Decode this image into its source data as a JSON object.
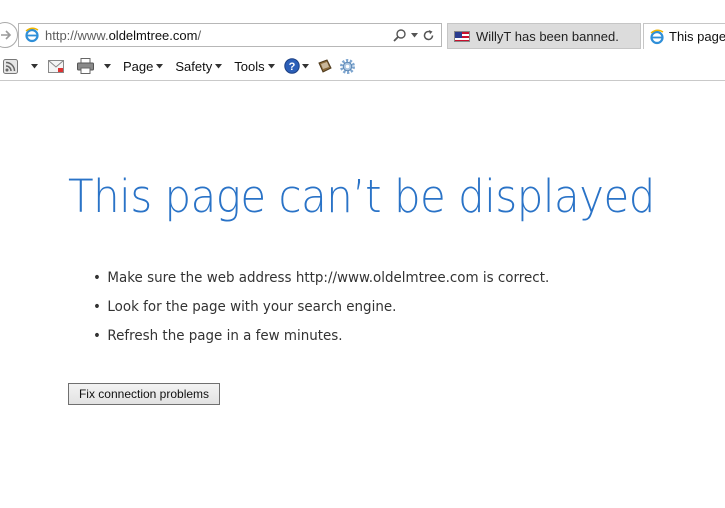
{
  "browser": {
    "address": {
      "prefix": "http://www.",
      "host": "oldelmtree.com",
      "suffix": "/"
    },
    "tabs": [
      {
        "label": "WillyT has been banned.",
        "icon": "us-flag-icon",
        "active": false
      },
      {
        "label": "This page c",
        "icon": "ie-icon",
        "active": true
      }
    ],
    "command_bar": {
      "page_label": "Page",
      "safety_label": "Safety",
      "tools_label": "Tools"
    }
  },
  "error_page": {
    "title": "This page can’t be displayed",
    "suggestions": [
      "Make sure the web address http://www.oldelmtree.com is correct.",
      "Look for the page with your search engine.",
      "Refresh the page in a few minutes."
    ],
    "fix_button_label": "Fix connection problems"
  },
  "colors": {
    "title_blue": "#2a73c7",
    "tab_inactive_bg": "#dcdcdc"
  }
}
